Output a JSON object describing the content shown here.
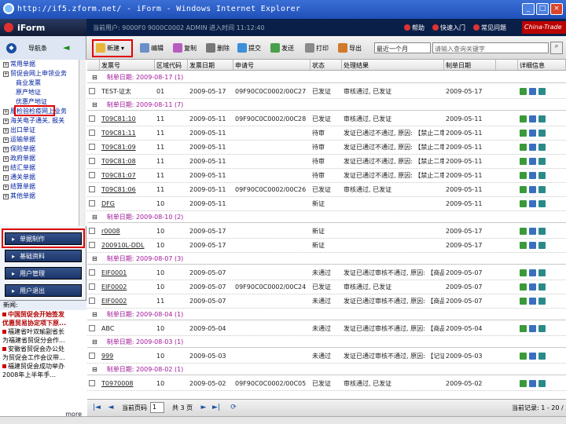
{
  "window": {
    "title": "http://if5.zform.net/ - iForm - Windows Internet Explorer"
  },
  "header": {
    "logo": "iForm",
    "user_info": "当前用户: 9000F0 9000C0002 ADMIN  进入时间 11:12:40",
    "links": [
      "帮助",
      "快速入门",
      "常见问题"
    ],
    "brand": "China-Trade"
  },
  "toolbar": {
    "nav_label": "导航条",
    "buttons": [
      "新建",
      "编辑",
      "复制",
      "删除",
      "提交",
      "发送",
      "打印",
      "导出"
    ],
    "period": "最近一个月",
    "search_placeholder": "请输入查询关键字"
  },
  "sidebar": {
    "tree": [
      {
        "label": "常用单据",
        "level": 0
      },
      {
        "label": "贸促会网上申领业务",
        "level": 0
      },
      {
        "label": "商业发票",
        "level": 1
      },
      {
        "label": "原产地证",
        "level": 1
      },
      {
        "label": "优惠产地证",
        "level": 1
      },
      {
        "label": "原检验检疫网上业务",
        "level": 0
      },
      {
        "label": "海关电子通关, 报关",
        "level": 0
      },
      {
        "label": "出口单证",
        "level": 0
      },
      {
        "label": "运输单据",
        "level": 0
      },
      {
        "label": "保险单据",
        "level": 0
      },
      {
        "label": "政府单据",
        "level": 0
      },
      {
        "label": "结汇单据",
        "level": 0
      },
      {
        "label": "通关单据",
        "level": 0
      },
      {
        "label": "结算单据",
        "level": 0
      },
      {
        "label": "其他单据",
        "level": 0
      }
    ],
    "menu": [
      "单据制作",
      "基础资料",
      "用户管理",
      "用户退出"
    ],
    "news_title": "新闻:",
    "news": [
      {
        "text": "中国贸促会开始签发",
        "red": true
      },
      {
        "text": "优惠贸易协定项下原...",
        "red": true
      },
      {
        "text": "福建省叶双瑜副省长",
        "red": false
      },
      {
        "text": "为福建省贸促分会作...",
        "red": false
      },
      {
        "text": "安徽省贸促会办公处",
        "red": false
      },
      {
        "text": "为贸促会工作会议带...",
        "red": false
      },
      {
        "text": "福建贸促会成功举办",
        "red": false
      },
      {
        "text": "2008年上半年手...",
        "red": false
      }
    ],
    "more": "more"
  },
  "table": {
    "columns": [
      "",
      "发票号",
      "区域代码",
      "发票日期",
      "申请号",
      "状态",
      "处理结果",
      "制单日期",
      "",
      "详细信息"
    ],
    "groups": [
      {
        "label": "制单日期: 2009-08-17 (1)",
        "rows": [
          {
            "inv": "TEST-证太",
            "area": "01",
            "date": "2009-05-17",
            "app": "09F90C0C0002/00C27",
            "status": "已发证",
            "result": "审核通过, 已发证",
            "made": "2009-05-17",
            "ul": false
          }
        ]
      },
      {
        "label": "制单日期: 2009-08-11 (7)",
        "rows": [
          {
            "inv": "T09C81:10",
            "area": "11",
            "date": "2009-05-11",
            "app": "09F90C0C0002/00C28",
            "status": "已发证",
            "result": "审核通过, 已发证",
            "made": "2009-05-11",
            "ul": true
          },
          {
            "inv": "T09C81:11",
            "area": "11",
            "date": "2009-05-11",
            "app": "",
            "status": "待审",
            "result": "发证已通过不通过, 原因: 【禁止二审不...",
            "made": "2009-05-11",
            "ul": true
          },
          {
            "inv": "T09C81:09",
            "area": "11",
            "date": "2009-05-11",
            "app": "",
            "status": "待审",
            "result": "发证已通过不通过, 原因: 【禁止二审不...",
            "made": "2009-05-11",
            "ul": true
          },
          {
            "inv": "T09C81:08",
            "area": "11",
            "date": "2009-05-11",
            "app": "",
            "status": "待审",
            "result": "发证已通过不通过, 原因: 【禁止二审不...",
            "made": "2009-05-11",
            "ul": true
          },
          {
            "inv": "T09C81:07",
            "area": "11",
            "date": "2009-05-11",
            "app": "",
            "status": "待审",
            "result": "发证已通过不通过, 原因: 【禁止二审不...",
            "made": "2009-05-11",
            "ul": true
          },
          {
            "inv": "T09C81:06",
            "area": "11",
            "date": "2009-05-11",
            "app": "09F90C0C0002/00C26",
            "status": "已发证",
            "result": "审核通过, 已发证",
            "made": "2009-05-11",
            "ul": true
          },
          {
            "inv": "DFG",
            "area": "10",
            "date": "2009-05-11",
            "app": "",
            "status": "新证",
            "result": "",
            "made": "2009-05-11",
            "ul": true
          }
        ]
      },
      {
        "label": "制单日期: 2009-08-10 (2)",
        "rows": [
          {
            "inv": "r0008",
            "area": "10",
            "date": "2009-05-17",
            "app": "",
            "status": "新证",
            "result": "",
            "made": "2009-05-17",
            "ul": true
          },
          {
            "inv": "200910L-DDL",
            "area": "10",
            "date": "2009-05-17",
            "app": "",
            "status": "新证",
            "result": "",
            "made": "2009-05-17",
            "ul": true
          }
        ]
      },
      {
        "label": "制单日期: 2009-08-07 (3)",
        "rows": [
          {
            "inv": "EIF0001",
            "area": "10",
            "date": "2009-05-07",
            "app": "",
            "status": "未通过",
            "result": "发证已通过审核不通过, 原因: 【商品未经签发...",
            "made": "2009-05-07",
            "ul": true
          },
          {
            "inv": "EIF0002",
            "area": "10",
            "date": "2009-05-07",
            "app": "09F90C0C0002/00C24",
            "status": "已发证",
            "result": "审核通过, 已发证",
            "made": "2009-05-07",
            "ul": true
          },
          {
            "inv": "EIF0002",
            "area": "11",
            "date": "2009-05-07",
            "app": "",
            "status": "未通过",
            "result": "发证已通过审核不通过, 原因: 【商品未经签发...",
            "made": "2009-05-07",
            "ul": true
          }
        ]
      },
      {
        "label": "制单日期: 2009-08-04 (1)",
        "rows": [
          {
            "inv": "ABC",
            "area": "10",
            "date": "2009-05-04",
            "app": "",
            "status": "未通过",
            "result": "发证已通过审核不通过, 原因: 【商品未经签发...",
            "made": "2009-05-04",
            "ul": false
          }
        ]
      },
      {
        "label": "制单日期: 2009-08-03 (1)",
        "rows": [
          {
            "inv": "999",
            "area": "10",
            "date": "2009-05-03",
            "app": "",
            "status": "未通过",
            "result": "发证已通过审核不通过, 原因: 【记证签发已不...",
            "made": "2009-05-03",
            "ul": true
          }
        ]
      },
      {
        "label": "制单日期: 2009-08-02 (1)",
        "rows": [
          {
            "inv": "T0970008",
            "area": "10",
            "date": "2009-05-02",
            "app": "09F90C0C0002/00C05",
            "status": "已发证",
            "result": "审核通过, 已发证",
            "made": "2009-05-02",
            "ul": true
          }
        ]
      }
    ]
  },
  "pager": {
    "page_label": "当前页码",
    "page_value": "1",
    "total_pages": "共 3 页",
    "record_info": "当前记录: 1 - 20 / 27"
  },
  "colors": {
    "accent_red": "#e00000",
    "group_date": "#a0189a",
    "nav_dark": "#0a1f48"
  }
}
